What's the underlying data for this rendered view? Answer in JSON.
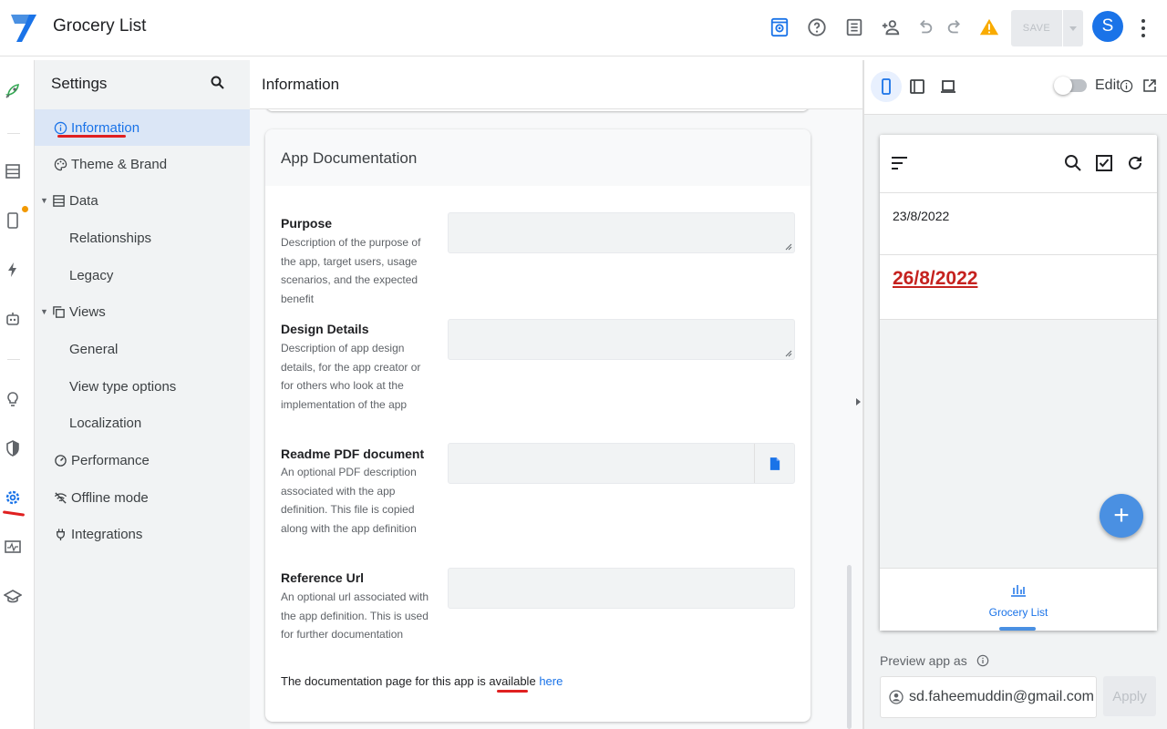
{
  "header": {
    "app_title": "Grocery List",
    "save_label": "SAVE",
    "avatar_initial": "S",
    "icons": [
      "logo-icon",
      "preview-icon",
      "help-icon",
      "notebook-icon",
      "add-person-icon",
      "undo-icon",
      "redo-icon",
      "warning-icon",
      "chevron-down-icon",
      "more-vert-icon"
    ]
  },
  "rail": {
    "icons": [
      "rocket-icon",
      "table-icon",
      "phone-icon",
      "bolt-icon",
      "robot-icon",
      "bulb-icon",
      "shield-icon",
      "gear-icon",
      "monitor-icon",
      "graduation-icon"
    ]
  },
  "nav": {
    "header": "Settings",
    "items": [
      {
        "label": "Information",
        "icon": "info-icon"
      },
      {
        "label": "Theme & Brand",
        "icon": "palette-icon"
      },
      {
        "label": "Data",
        "icon": "table-icon"
      },
      {
        "label": "Relationships"
      },
      {
        "label": "Legacy"
      },
      {
        "label": "Views",
        "icon": "copy-icon"
      },
      {
        "label": "General"
      },
      {
        "label": "View type options"
      },
      {
        "label": "Localization"
      },
      {
        "label": "Performance",
        "icon": "speed-icon"
      },
      {
        "label": "Offline mode",
        "icon": "wifi-off-icon"
      },
      {
        "label": "Integrations",
        "icon": "plug-icon"
      }
    ]
  },
  "main": {
    "title": "Information",
    "card_title": "App Documentation",
    "fields": [
      {
        "label": "Purpose",
        "desc": "Description of the purpose of the app, target users, usage scenarios, and the expected benefit",
        "value": ""
      },
      {
        "label": "Design Details",
        "desc": "Description of app design details, for the app creator or for others who look at the implementation of the app",
        "value": ""
      },
      {
        "label": "Readme PDF document",
        "desc": "An optional PDF description associated with the app definition. This file is copied along with the app definition",
        "value": ""
      },
      {
        "label": "Reference Url",
        "desc": "An optional url associated with the app definition. This is used for further documentation",
        "value": ""
      }
    ],
    "doc_text": "The documentation page for this app is available",
    "doc_link": "here"
  },
  "preview": {
    "edit_label": "Edit",
    "rows": [
      "23/8/2022",
      "26/8/2022"
    ],
    "fab_label": "+",
    "tab_label": "Grocery List",
    "preview_as_label": "Preview app as",
    "email": "sd.faheemuddin@gmail.com",
    "apply_label": "Apply"
  },
  "colors": {
    "accent": "#1a73e8",
    "warning": "#f9ab00",
    "date_red": "#c5221f",
    "annotation_red": "#e02020"
  }
}
